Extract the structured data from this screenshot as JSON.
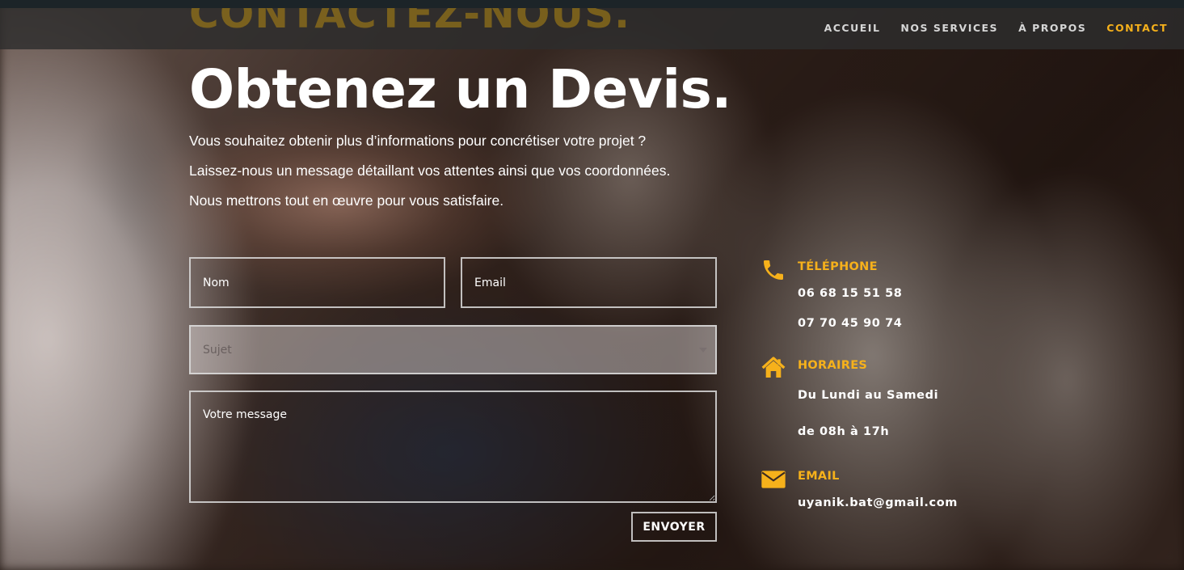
{
  "header": {
    "ghost_title": "CONTACTEZ-NOUS.",
    "nav": [
      {
        "label": "ACCUEIL"
      },
      {
        "label": "NOS SERVICES"
      },
      {
        "label": "À PROPOS"
      },
      {
        "label": "CONTACT"
      }
    ],
    "active_nav": "CONTACT"
  },
  "main": {
    "title": "Obtenez un Devis.",
    "intro": [
      "Vous souhaitez obtenir plus d’informations pour concrétiser votre projet ?",
      "Laissez-nous un message détaillant vos attentes ainsi que vos coordonnées.",
      "Nous mettrons tout en œuvre pour vous satisfaire."
    ]
  },
  "form": {
    "name_placeholder": "Nom",
    "email_placeholder": "Email",
    "subject_placeholder": "Sujet",
    "message_placeholder": "Votre message",
    "submit_label": "ENVOYER"
  },
  "contact": {
    "phone": {
      "title": "TÉLÉPHONE",
      "lines": [
        "06 68 15 51 58",
        "07 70 45 90 74"
      ],
      "icon": "phone-icon"
    },
    "hours": {
      "title": "HORAIRES",
      "lines": [
        "Du Lundi au Samedi",
        "de 08h à 17h"
      ],
      "icon": "home-icon"
    },
    "email": {
      "title": "EMAIL",
      "lines": [
        "uyanik.bat@gmail.com"
      ],
      "icon": "envelope-icon"
    }
  },
  "colors": {
    "accent": "#f6b11b",
    "text": "#ffffff",
    "header_bg": "#2d2d2d"
  }
}
